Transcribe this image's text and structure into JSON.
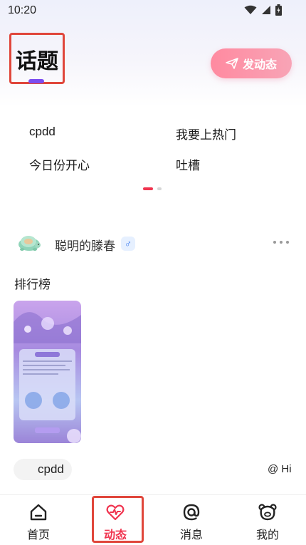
{
  "status_bar": {
    "time": "10:20"
  },
  "header": {
    "title": "话题",
    "post_button_label": "发动态"
  },
  "topics": {
    "items": [
      "cpdd",
      "我要上热门",
      "今日份开心",
      "吐槽"
    ]
  },
  "post": {
    "username": "聪明的滕春",
    "gender_symbol": "♂",
    "text": "排行榜",
    "topic_tag": "cpdd",
    "mention": "@ Hi"
  },
  "bottom_nav": {
    "items": [
      {
        "label": "首页",
        "icon": "home-icon"
      },
      {
        "label": "动态",
        "icon": "heart-pulse-icon"
      },
      {
        "label": "消息",
        "icon": "at-icon"
      },
      {
        "label": "我的",
        "icon": "bear-face-icon"
      }
    ],
    "active_index": 1
  },
  "colors": {
    "accent": "#f0344f",
    "highlight_frame": "#e0463b",
    "title_indicator": "#7b4df0",
    "post_button": "#ff8aa0"
  }
}
